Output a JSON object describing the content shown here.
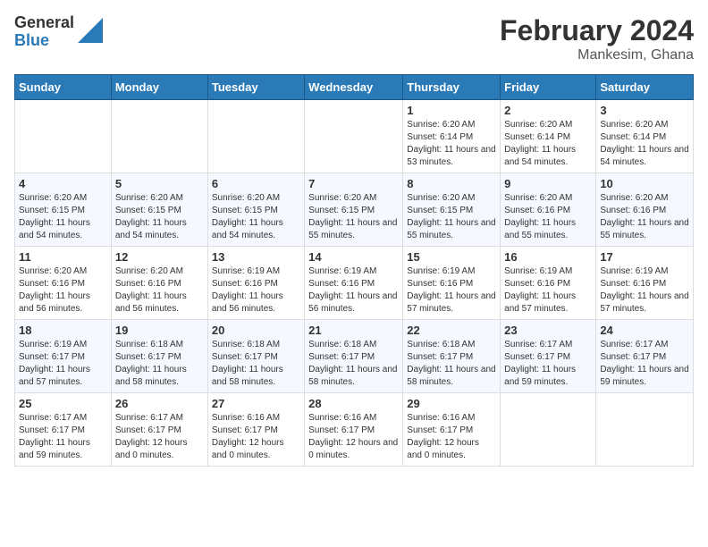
{
  "logo": {
    "general": "General",
    "blue": "Blue"
  },
  "title": "February 2024",
  "subtitle": "Mankesim, Ghana",
  "days_header": [
    "Sunday",
    "Monday",
    "Tuesday",
    "Wednesday",
    "Thursday",
    "Friday",
    "Saturday"
  ],
  "weeks": [
    [
      {
        "day": "",
        "sunrise": "",
        "sunset": "",
        "daylight": ""
      },
      {
        "day": "",
        "sunrise": "",
        "sunset": "",
        "daylight": ""
      },
      {
        "day": "",
        "sunrise": "",
        "sunset": "",
        "daylight": ""
      },
      {
        "day": "",
        "sunrise": "",
        "sunset": "",
        "daylight": ""
      },
      {
        "day": "1",
        "sunrise": "Sunrise: 6:20 AM",
        "sunset": "Sunset: 6:14 PM",
        "daylight": "Daylight: 11 hours and 53 minutes."
      },
      {
        "day": "2",
        "sunrise": "Sunrise: 6:20 AM",
        "sunset": "Sunset: 6:14 PM",
        "daylight": "Daylight: 11 hours and 54 minutes."
      },
      {
        "day": "3",
        "sunrise": "Sunrise: 6:20 AM",
        "sunset": "Sunset: 6:14 PM",
        "daylight": "Daylight: 11 hours and 54 minutes."
      }
    ],
    [
      {
        "day": "4",
        "sunrise": "Sunrise: 6:20 AM",
        "sunset": "Sunset: 6:15 PM",
        "daylight": "Daylight: 11 hours and 54 minutes."
      },
      {
        "day": "5",
        "sunrise": "Sunrise: 6:20 AM",
        "sunset": "Sunset: 6:15 PM",
        "daylight": "Daylight: 11 hours and 54 minutes."
      },
      {
        "day": "6",
        "sunrise": "Sunrise: 6:20 AM",
        "sunset": "Sunset: 6:15 PM",
        "daylight": "Daylight: 11 hours and 54 minutes."
      },
      {
        "day": "7",
        "sunrise": "Sunrise: 6:20 AM",
        "sunset": "Sunset: 6:15 PM",
        "daylight": "Daylight: 11 hours and 55 minutes."
      },
      {
        "day": "8",
        "sunrise": "Sunrise: 6:20 AM",
        "sunset": "Sunset: 6:15 PM",
        "daylight": "Daylight: 11 hours and 55 minutes."
      },
      {
        "day": "9",
        "sunrise": "Sunrise: 6:20 AM",
        "sunset": "Sunset: 6:16 PM",
        "daylight": "Daylight: 11 hours and 55 minutes."
      },
      {
        "day": "10",
        "sunrise": "Sunrise: 6:20 AM",
        "sunset": "Sunset: 6:16 PM",
        "daylight": "Daylight: 11 hours and 55 minutes."
      }
    ],
    [
      {
        "day": "11",
        "sunrise": "Sunrise: 6:20 AM",
        "sunset": "Sunset: 6:16 PM",
        "daylight": "Daylight: 11 hours and 56 minutes."
      },
      {
        "day": "12",
        "sunrise": "Sunrise: 6:20 AM",
        "sunset": "Sunset: 6:16 PM",
        "daylight": "Daylight: 11 hours and 56 minutes."
      },
      {
        "day": "13",
        "sunrise": "Sunrise: 6:19 AM",
        "sunset": "Sunset: 6:16 PM",
        "daylight": "Daylight: 11 hours and 56 minutes."
      },
      {
        "day": "14",
        "sunrise": "Sunrise: 6:19 AM",
        "sunset": "Sunset: 6:16 PM",
        "daylight": "Daylight: 11 hours and 56 minutes."
      },
      {
        "day": "15",
        "sunrise": "Sunrise: 6:19 AM",
        "sunset": "Sunset: 6:16 PM",
        "daylight": "Daylight: 11 hours and 57 minutes."
      },
      {
        "day": "16",
        "sunrise": "Sunrise: 6:19 AM",
        "sunset": "Sunset: 6:16 PM",
        "daylight": "Daylight: 11 hours and 57 minutes."
      },
      {
        "day": "17",
        "sunrise": "Sunrise: 6:19 AM",
        "sunset": "Sunset: 6:16 PM",
        "daylight": "Daylight: 11 hours and 57 minutes."
      }
    ],
    [
      {
        "day": "18",
        "sunrise": "Sunrise: 6:19 AM",
        "sunset": "Sunset: 6:17 PM",
        "daylight": "Daylight: 11 hours and 57 minutes."
      },
      {
        "day": "19",
        "sunrise": "Sunrise: 6:18 AM",
        "sunset": "Sunset: 6:17 PM",
        "daylight": "Daylight: 11 hours and 58 minutes."
      },
      {
        "day": "20",
        "sunrise": "Sunrise: 6:18 AM",
        "sunset": "Sunset: 6:17 PM",
        "daylight": "Daylight: 11 hours and 58 minutes."
      },
      {
        "day": "21",
        "sunrise": "Sunrise: 6:18 AM",
        "sunset": "Sunset: 6:17 PM",
        "daylight": "Daylight: 11 hours and 58 minutes."
      },
      {
        "day": "22",
        "sunrise": "Sunrise: 6:18 AM",
        "sunset": "Sunset: 6:17 PM",
        "daylight": "Daylight: 11 hours and 58 minutes."
      },
      {
        "day": "23",
        "sunrise": "Sunrise: 6:17 AM",
        "sunset": "Sunset: 6:17 PM",
        "daylight": "Daylight: 11 hours and 59 minutes."
      },
      {
        "day": "24",
        "sunrise": "Sunrise: 6:17 AM",
        "sunset": "Sunset: 6:17 PM",
        "daylight": "Daylight: 11 hours and 59 minutes."
      }
    ],
    [
      {
        "day": "25",
        "sunrise": "Sunrise: 6:17 AM",
        "sunset": "Sunset: 6:17 PM",
        "daylight": "Daylight: 11 hours and 59 minutes."
      },
      {
        "day": "26",
        "sunrise": "Sunrise: 6:17 AM",
        "sunset": "Sunset: 6:17 PM",
        "daylight": "Daylight: 12 hours and 0 minutes."
      },
      {
        "day": "27",
        "sunrise": "Sunrise: 6:16 AM",
        "sunset": "Sunset: 6:17 PM",
        "daylight": "Daylight: 12 hours and 0 minutes."
      },
      {
        "day": "28",
        "sunrise": "Sunrise: 6:16 AM",
        "sunset": "Sunset: 6:17 PM",
        "daylight": "Daylight: 12 hours and 0 minutes."
      },
      {
        "day": "29",
        "sunrise": "Sunrise: 6:16 AM",
        "sunset": "Sunset: 6:17 PM",
        "daylight": "Daylight: 12 hours and 0 minutes."
      },
      {
        "day": "",
        "sunrise": "",
        "sunset": "",
        "daylight": ""
      },
      {
        "day": "",
        "sunrise": "",
        "sunset": "",
        "daylight": ""
      }
    ]
  ]
}
